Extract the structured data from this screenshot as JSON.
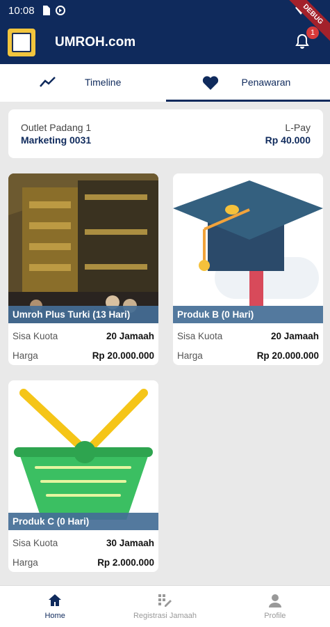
{
  "status_bar": {
    "time": "10:08"
  },
  "debug_ribbon": "DEBUG",
  "app_bar": {
    "title": "UMROH.com",
    "notification_count": "1"
  },
  "tabs": [
    {
      "label": "Timeline",
      "icon": "trend-line-icon"
    },
    {
      "label": "Penawaran",
      "icon": "heart-icon"
    }
  ],
  "info": {
    "outlet": "Outlet Padang 1",
    "marketing": "Marketing 0031",
    "lpay_label": "L-Pay",
    "lpay_value": "Rp 40.000"
  },
  "products": [
    {
      "name": "Umroh Plus Turki (13 Hari)",
      "kuota_label": "Sisa Kuota",
      "kuota_value": "20 Jamaah",
      "harga_label": "Harga",
      "harga_value": "Rp 20.000.000",
      "image": "kaaba-photo"
    },
    {
      "name": "Produk B (0 Hari)",
      "kuota_label": "Sisa Kuota",
      "kuota_value": "20 Jamaah",
      "harga_label": "Harga",
      "harga_value": "Rp 20.000.000",
      "image": "graduation-cap"
    },
    {
      "name": "Produk C (0 Hari)",
      "kuota_label": "Sisa Kuota",
      "kuota_value": "30 Jamaah",
      "harga_label": "Harga",
      "harga_value": "Rp 2.000.000",
      "image": "basket"
    }
  ],
  "bottom_nav": [
    {
      "label": "Home",
      "icon": "home-icon"
    },
    {
      "label": "Registrasi Jamaah",
      "icon": "edit-grid-icon"
    },
    {
      "label": "Profile",
      "icon": "person-icon"
    }
  ],
  "colors": {
    "primary": "#0f2a5c",
    "strip": "#446e96",
    "badge": "#d83a3a"
  }
}
